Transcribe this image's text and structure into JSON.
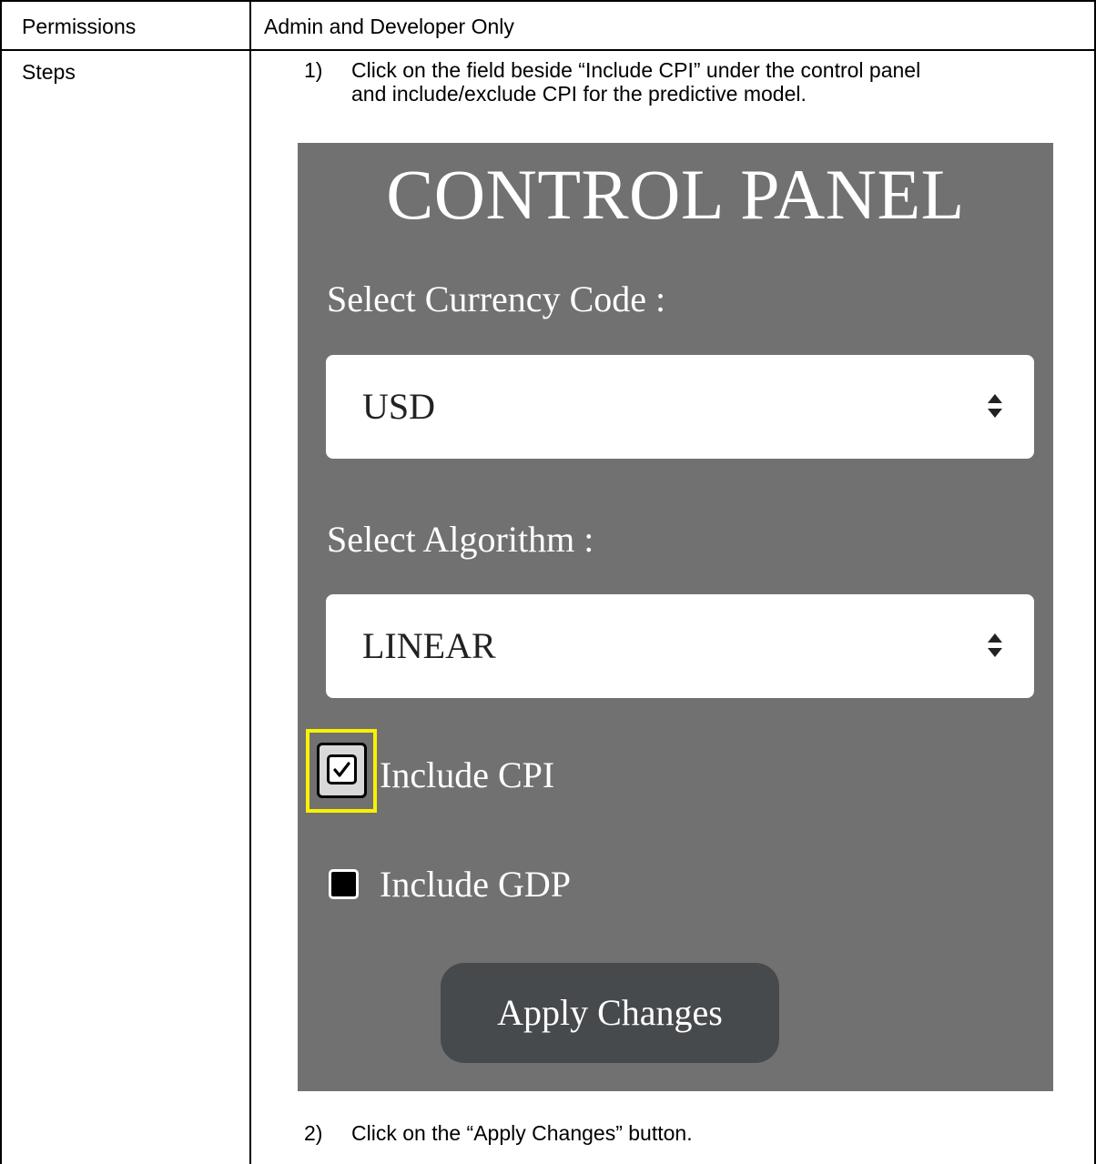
{
  "table": {
    "row1": {
      "label": "Permissions",
      "value": "Admin and Developer Only"
    },
    "row2": {
      "label": "Steps"
    }
  },
  "steps": [
    {
      "number": "1)",
      "line1": "Click on the field beside “Include CPI” under the control panel",
      "line2": "and include/exclude CPI for the predictive model."
    },
    {
      "number": "2)",
      "text": "Click on the “Apply Changes” button."
    }
  ],
  "control_panel": {
    "title": "CONTROL PANEL",
    "currency_label": "Select Currency Code :",
    "currency_value": "USD",
    "algorithm_label": "Select Algorithm :",
    "algorithm_value": "LINEAR",
    "include_cpi": {
      "label": "Include CPI",
      "checked": true
    },
    "include_gdp": {
      "label": "Include GDP",
      "checked": false
    },
    "apply_button": "Apply Changes",
    "background_color": "#717171",
    "highlight_color": "#f8f200"
  }
}
